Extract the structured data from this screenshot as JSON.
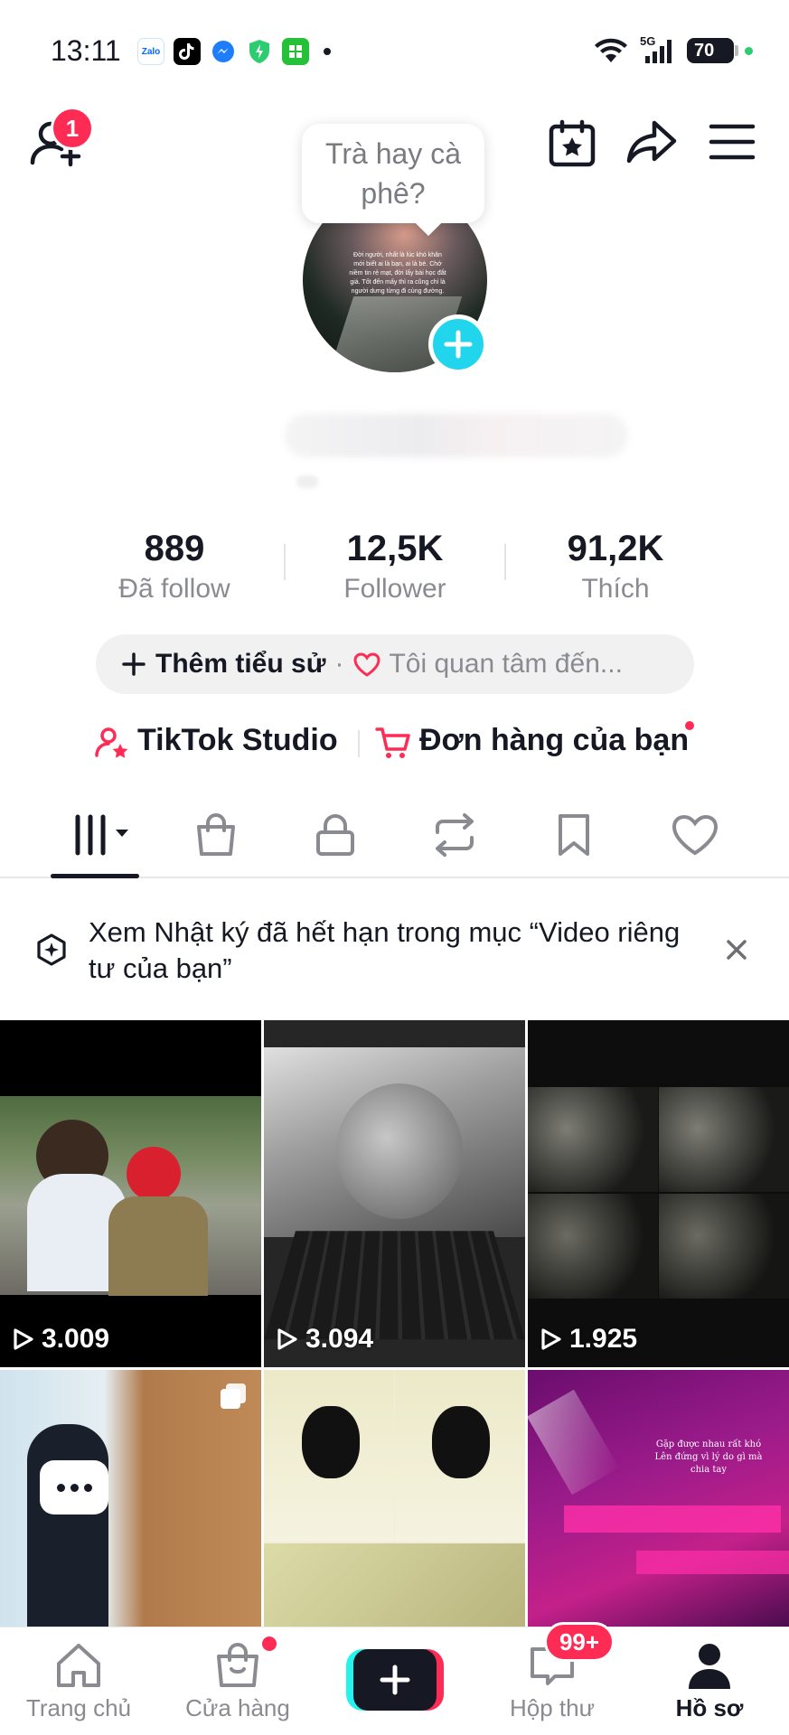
{
  "status_bar": {
    "time": "13:11",
    "apps": [
      "Zalo",
      "TikTok",
      "Messenger",
      "Shield",
      "App"
    ],
    "network": "5G",
    "battery": "70"
  },
  "header": {
    "friends_badge": "1"
  },
  "profile": {
    "note_bubble": "Trà hay cà phê?",
    "avatar_text": "Đời người, nhất là lúc khó khăn mới biết ai là bạn, ai là bè. Chớ niềm tin rẻ mạt, đời lấy bài học đắt giá. Tốt đến mấy thì ra cũng chỉ là người dưng từng đi cùng đường."
  },
  "stats": [
    {
      "value": "889",
      "label": "Đã follow"
    },
    {
      "value": "12,5K",
      "label": "Follower"
    },
    {
      "value": "91,2K",
      "label": "Thích"
    }
  ],
  "bio": {
    "add_label": "Thêm tiểu sử",
    "separator": "·",
    "interest_label": "Tôi quan tâm đến..."
  },
  "links": {
    "studio": "TikTok Studio",
    "orders": "Đơn hàng của bạn"
  },
  "notice": {
    "text": "Xem Nhật ký đã hết hạn trong mục “Video riêng tư của bạn”"
  },
  "videos": [
    {
      "views": "3.009"
    },
    {
      "views": "3.094"
    },
    {
      "views": "1.925"
    },
    {
      "views": ""
    },
    {
      "views": ""
    },
    {
      "views": "",
      "caption": "Gặp được nhau rất khó Lên đứng vì lý do gì mà chia tay"
    }
  ],
  "nav": {
    "home": "Trang chủ",
    "shop": "Cửa hàng",
    "inbox": "Hộp thư",
    "inbox_badge": "99+",
    "profile": "Hồ sơ"
  },
  "colors": {
    "accent_red": "#fe2c55",
    "accent_cyan": "#20d5ec",
    "text_primary": "#161823",
    "text_secondary": "#8a8b91"
  }
}
